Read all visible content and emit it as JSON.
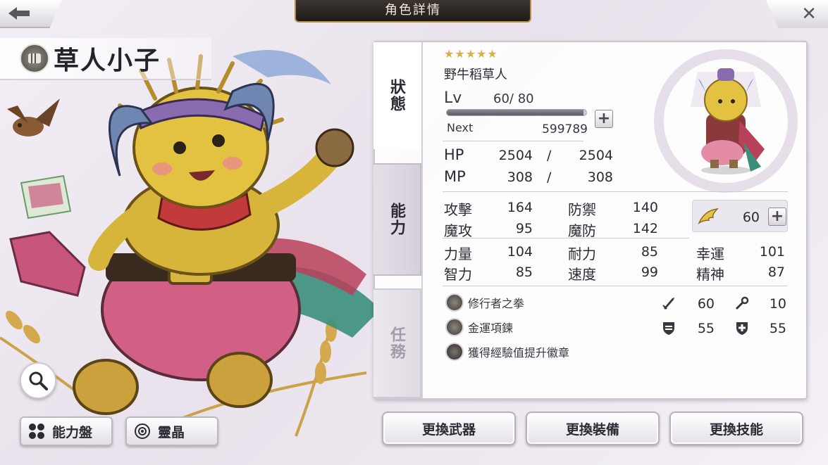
{
  "header": {
    "title": "角色詳情",
    "back_icon": "arrow-left-icon",
    "close_icon": "close-icon",
    "close_glyph": "✕"
  },
  "character": {
    "name": "草人小子",
    "stars": "★★★★★",
    "rarity": 5,
    "subname": "野牛稻草人",
    "lv_label": "Lv",
    "level": "60",
    "level_sep": "/",
    "level_max": "80",
    "exp_fraction": 0.98,
    "next_label": "Next",
    "next_value": "599789"
  },
  "tabs": {
    "status": "狀態",
    "ability": "能力",
    "mission": "任務"
  },
  "stats": {
    "hp_label": "HP",
    "hp": "2504",
    "hp_max": "2504",
    "mp_label": "MP",
    "mp": "308",
    "mp_max": "308",
    "slash": "/",
    "atk_label": "攻擊",
    "atk": "164",
    "def_label": "防禦",
    "def": "140",
    "matk_label": "魔攻",
    "matk": "95",
    "mdef_label": "魔防",
    "mdef": "142",
    "str_label": "力量",
    "str": "104",
    "vit_label": "耐力",
    "vit": "85",
    "luck_label": "幸運",
    "luck": "101",
    "int_label": "智力",
    "int": "85",
    "spd_label": "速度",
    "spd": "99",
    "spirit_label": "精神",
    "spirit": "87",
    "wing_value": "60"
  },
  "equipment": [
    {
      "name": "修行者之拳",
      "icon": "fist-weapon-icon"
    },
    {
      "name": "金運項鍊",
      "icon": "necklace-icon"
    },
    {
      "name": "獲得經驗值提升徽章",
      "icon": "badge-icon"
    }
  ],
  "equip_stats": {
    "sword": "60",
    "wand": "10",
    "shield": "55",
    "cross_shield": "55"
  },
  "buttons": {
    "ability_board": "能力盤",
    "spirit_crystal": "靈晶",
    "change_weapon": "更換武器",
    "change_equipment": "更換裝備",
    "change_skill": "更換技能"
  },
  "colors": {
    "accent_gold": "#d9b14a",
    "title_plate": "#2a2420",
    "panel_border": "#cdc6d2"
  }
}
